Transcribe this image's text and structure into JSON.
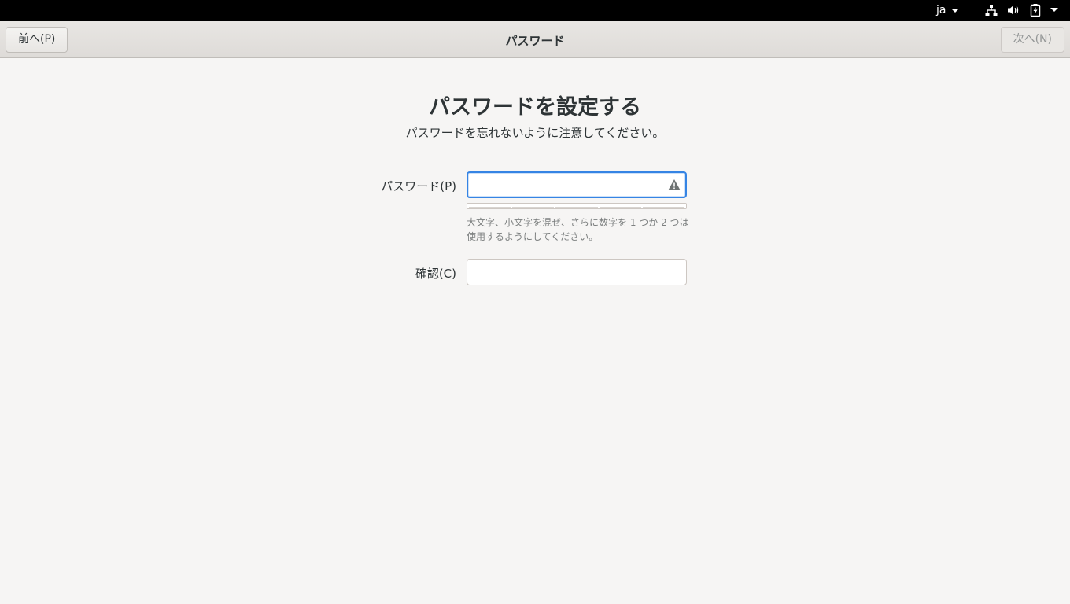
{
  "topbar": {
    "language": "ja",
    "icons": [
      "network-wired-icon",
      "volume-icon",
      "battery-charging-icon",
      "system-menu-caret-icon"
    ]
  },
  "header": {
    "back_label": "前へ(P)",
    "title": "パスワード",
    "next_label": "次へ(N)"
  },
  "main": {
    "title": "パスワードを設定する",
    "subtitle": "パスワードを忘れないように注意してください。",
    "password_label": "パスワード(P)",
    "password_value": "",
    "password_strength_segments": 5,
    "password_strength_level": 0,
    "hint_line1": "大文字、小文字を混ぜ、さらに数字を 1 つか 2 つは",
    "hint_line2": "使用するようにしてください。",
    "confirm_label": "確認(C)",
    "confirm_value": ""
  },
  "colors": {
    "accent": "#3584e4",
    "background": "#f6f5f4",
    "topbar": "#000000"
  }
}
